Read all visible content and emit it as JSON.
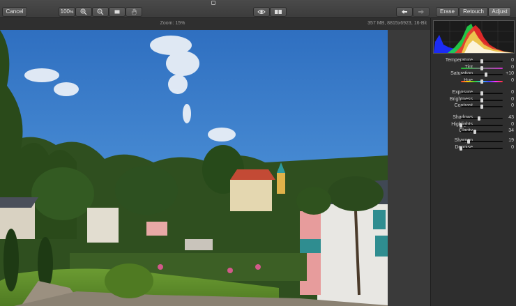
{
  "toolbar": {
    "cancel_label": "Cancel",
    "zoom_value": "100",
    "zoom_unit": "%",
    "zoom_in_icon": "zoom-in-icon",
    "zoom_out_icon": "zoom-out-icon",
    "fit_icon": "fit-screen-icon",
    "pan_icon": "hand-pan-icon",
    "preview_icon": "eye-icon",
    "compare_icon": "split-view-icon",
    "undo_icon": "undo-arrow-icon",
    "redo_icon": "redo-arrow-icon",
    "modes": [
      {
        "label": "Erase",
        "active": false
      },
      {
        "label": "Retouch",
        "active": false
      },
      {
        "label": "Adjust",
        "active": true
      }
    ]
  },
  "status": {
    "zoom_text": "Zoom: 15%",
    "file_info": "357 MB, 8815x6923, 16-Bit"
  },
  "adjustments": {
    "groups": [
      [
        {
          "label": "Temperature",
          "value": "0",
          "position": 0.5,
          "gradient": "none"
        },
        {
          "label": "Tint",
          "value": "0",
          "position": 0.5,
          "gradient": "tint"
        },
        {
          "label": "Saturation",
          "value": "+10",
          "position": 0.6,
          "gradient": "none"
        },
        {
          "label": "Hue",
          "value": "0",
          "position": 0.5,
          "gradient": "hue"
        }
      ],
      [
        {
          "label": "Exposure",
          "value": "0",
          "position": 0.5,
          "gradient": "none"
        },
        {
          "label": "Brightness",
          "value": "0",
          "position": 0.5,
          "gradient": "none"
        },
        {
          "label": "Contrast",
          "value": "0",
          "position": 0.5,
          "gradient": "none"
        }
      ],
      [
        {
          "label": "Shadows",
          "value": "43",
          "position": 0.43,
          "gradient": "none"
        },
        {
          "label": "Highlights",
          "value": "0",
          "position": 0.0,
          "gradient": "none"
        },
        {
          "label": "Clarity",
          "value": "34",
          "position": 0.34,
          "gradient": "none"
        }
      ],
      [
        {
          "label": "Sharpen",
          "value": "19",
          "position": 0.19,
          "gradient": "none"
        },
        {
          "label": "Denoise",
          "value": "0",
          "position": 0.0,
          "gradient": "none"
        }
      ]
    ]
  },
  "colors": {
    "sky": "#3a7fc9",
    "grass": "#5a8a2a",
    "trees": "#2e4f1e"
  }
}
